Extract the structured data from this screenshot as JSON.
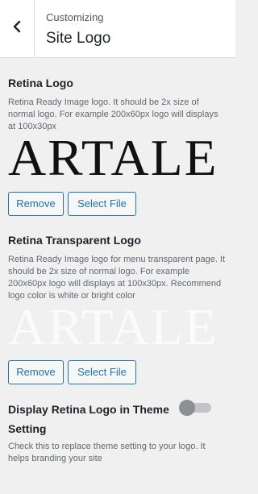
{
  "header": {
    "breadcrumb": "Customizing",
    "title": "Site Logo",
    "back_icon": "chevron-left-icon"
  },
  "retina_logo": {
    "title": "Retina Logo",
    "description": "Retina Ready Image logo. It should be 2x size of normal logo. For example 200x60px logo will displays at 100x30px",
    "preview_text": "ARTALE",
    "remove_label": "Remove",
    "select_label": "Select File"
  },
  "retina_transparent_logo": {
    "title": "Retina Transparent Logo",
    "description": "Retina Ready Image logo for menu transparent page. It should be 2x size of normal logo. For example 200x60px logo will displays at 100x30px. Recommend logo color is white or bright color",
    "preview_text": "ARTALE",
    "remove_label": "Remove",
    "select_label": "Select File"
  },
  "theme_setting": {
    "label": "Display Retina Logo in Theme Setting",
    "enabled": false,
    "description": "Check this to replace theme setting to your logo. It helps branding your site"
  },
  "colors": {
    "accent": "#2271b1",
    "background": "#f0f0f1",
    "header_bg": "#ffffff",
    "toggle_off": "#8c8f94"
  }
}
